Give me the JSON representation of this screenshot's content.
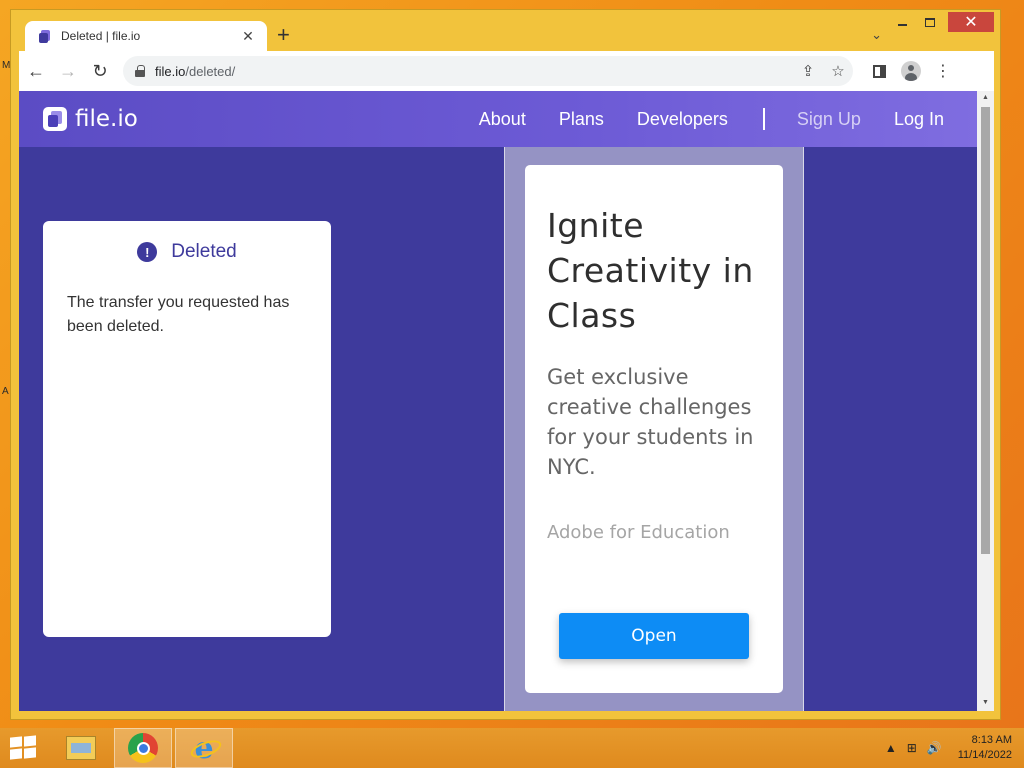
{
  "desktop": {
    "glyphs": [
      "M",
      "A"
    ]
  },
  "browser": {
    "tab_title": "Deleted | file.io",
    "tab_close": "✕",
    "new_tab": "+",
    "tab_dropdown": "⌄",
    "url_host": "file.io",
    "url_path": "/deleted/",
    "controls": {
      "back": "←",
      "forward": "→",
      "reload": "↻",
      "share": "⇪",
      "bookmark": "☆",
      "menu": "⋮"
    },
    "window": {
      "close": "✕"
    }
  },
  "site": {
    "logo": "file.io",
    "nav": [
      "About",
      "Plans",
      "Developers"
    ],
    "sign_up": "Sign Up",
    "log_in": "Log In"
  },
  "status_card": {
    "icon_glyph": "!",
    "title": "Deleted",
    "message": "The transfer you requested has been deleted."
  },
  "ad": {
    "title": "Ignite Creativity in Class",
    "text": "Get exclusive creative challenges for your students in NYC.",
    "brand": "Adobe for Education",
    "button": "Open"
  },
  "taskbar": {
    "time": "8:13 AM",
    "date": "11/14/2022",
    "tray": {
      "arrow": "▲",
      "network": "⊞",
      "volume": "🔊"
    }
  },
  "colors": {
    "page_bg": "#3e3a9c",
    "header_gradient_start": "#5b4cc4",
    "button_blue": "#0d8cf5",
    "window_frame": "#f2c33c",
    "taskbar": "#df8a1e",
    "close_red": "#c9463d"
  },
  "icons": [
    "tab-favicon",
    "lock-icon",
    "share-icon",
    "bookmark-star-icon",
    "side-panel-icon",
    "profile-icon",
    "menu-dots-icon",
    "alert-icon",
    "logo-icon",
    "windows-start-icon",
    "file-explorer-icon",
    "chrome-icon",
    "internet-explorer-icon"
  ]
}
